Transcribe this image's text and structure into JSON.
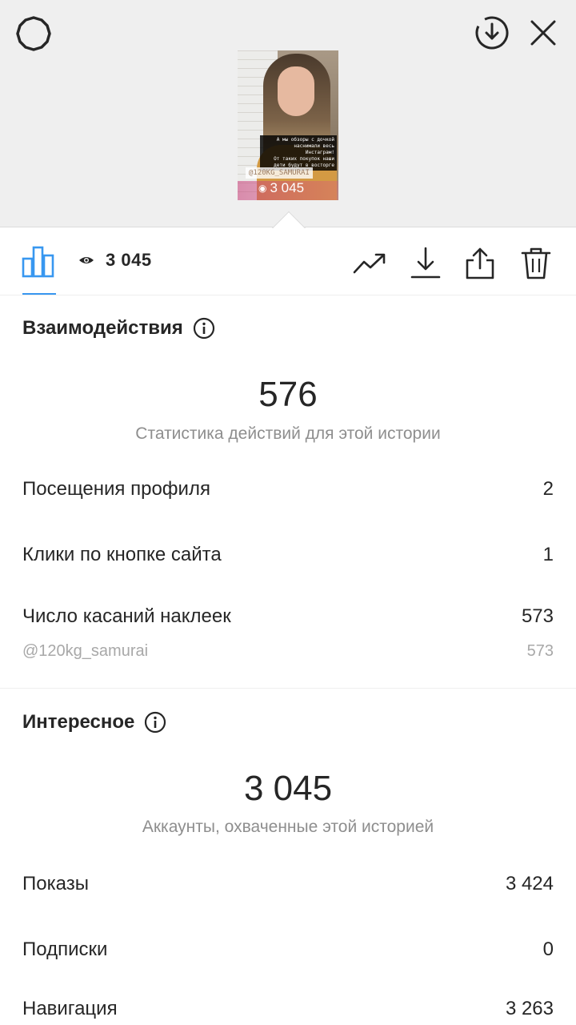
{
  "story": {
    "caption_lines": [
      "А мы обзоры с дочкой",
      "наснимали весь Инстаграм!",
      "От таких покупок наши",
      "дети будут в восторге"
    ],
    "mention": "@120KG_SAMURAI",
    "views": "3 045"
  },
  "toolbar": {
    "view_count": "3 045"
  },
  "interactions": {
    "title": "Взаимодействия",
    "total": "576",
    "total_label": "Статистика действий для этой истории",
    "rows": [
      {
        "label": "Посещения профиля",
        "value": "2"
      },
      {
        "label": "Клики по кнопке сайта",
        "value": "1"
      },
      {
        "label": "Число касаний наклеек",
        "value": "573"
      }
    ],
    "sub_row": {
      "label": "@120kg_samurai",
      "value": "573"
    }
  },
  "discovery": {
    "title": "Интересное",
    "total": "3 045",
    "total_label": "Аккаунты, охваченные этой историей",
    "rows": [
      {
        "label": "Показы",
        "value": "3 424"
      },
      {
        "label": "Подписки",
        "value": "0"
      },
      {
        "label": "Навигация",
        "value": "3 263"
      }
    ]
  },
  "colors": {
    "accent": "#3897f0",
    "text": "#262626",
    "secondary": "#8e8e8e",
    "top_bg": "#efefef"
  },
  "icons": [
    "settings-icon",
    "download-circle-icon",
    "close-icon",
    "bar-chart-icon",
    "eye-icon",
    "trend-icon",
    "download-icon",
    "share-icon",
    "trash-icon",
    "info-icon"
  ]
}
